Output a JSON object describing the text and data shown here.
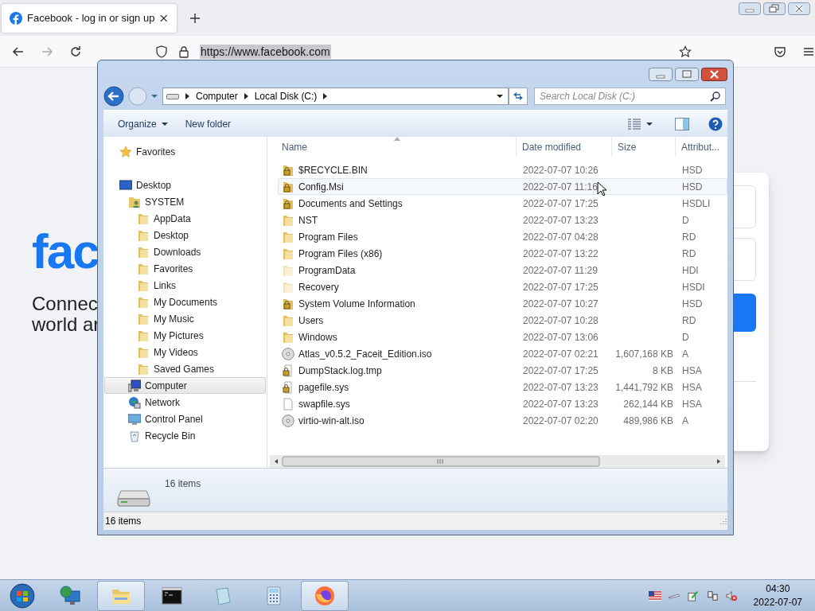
{
  "browser": {
    "tab": {
      "title": "Facebook - log in or sign up"
    },
    "url": "https://www.facebook.com",
    "page": {
      "logo": "fac",
      "tagline": [
        "Connec",
        "world ar"
      ]
    }
  },
  "dialog": {
    "breadcrumb": [
      "Computer",
      "Local Disk (C:)"
    ],
    "search": {
      "placeholder": "Search Local Disk (C:)"
    },
    "organize": "Organize",
    "new_folder": "New folder",
    "sidebar": [
      {
        "label": "Favorites",
        "kind": "favorites",
        "selected": false
      },
      {
        "label": "Desktop",
        "kind": "desktop",
        "selected": false,
        "children": [
          {
            "label": "SYSTEM",
            "kind": "user",
            "selected": false,
            "children": [
              {
                "label": "AppData",
                "kind": "folder",
                "selected": false
              },
              {
                "label": "Desktop",
                "kind": "folder",
                "selected": false
              },
              {
                "label": "Downloads",
                "kind": "folder",
                "selected": false
              },
              {
                "label": "Favorites",
                "kind": "folder",
                "selected": false
              },
              {
                "label": "Links",
                "kind": "folder",
                "selected": false
              },
              {
                "label": "My Documents",
                "kind": "folder",
                "selected": false
              },
              {
                "label": "My Music",
                "kind": "folder",
                "selected": false
              },
              {
                "label": "My Pictures",
                "kind": "folder",
                "selected": false
              },
              {
                "label": "My Videos",
                "kind": "folder",
                "selected": false
              },
              {
                "label": "Saved Games",
                "kind": "folder",
                "selected": false
              }
            ]
          },
          {
            "label": "Computer",
            "kind": "computer",
            "selected": true
          },
          {
            "label": "Network",
            "kind": "network",
            "selected": false
          },
          {
            "label": "Control Panel",
            "kind": "control-panel",
            "selected": false
          },
          {
            "label": "Recycle Bin",
            "kind": "recycle-bin",
            "selected": false
          }
        ]
      }
    ],
    "columns": [
      "Name",
      "Date modified",
      "Size",
      "Attribut..."
    ],
    "files": [
      {
        "name": "$RECYCLE.BIN",
        "date": "2022-07-07 10:26",
        "attributes": "HSD",
        "kind": "locked-folder",
        "highlighted": false
      },
      {
        "name": "Config.Msi",
        "date": "2022-07-07 11:16",
        "attributes": "HSD",
        "kind": "locked-folder",
        "highlighted": true
      },
      {
        "name": "Documents and Settings",
        "date": "2022-07-07 17:25",
        "attributes": "HSDLI",
        "kind": "locked-folder",
        "highlighted": false
      },
      {
        "name": "NST",
        "date": "2022-07-07 13:23",
        "attributes": "D",
        "kind": "folder",
        "highlighted": false
      },
      {
        "name": "Program Files",
        "date": "2022-07-07 04:28",
        "attributes": "RD",
        "kind": "folder",
        "highlighted": false
      },
      {
        "name": "Program Files (x86)",
        "date": "2022-07-07 13:22",
        "attributes": "RD",
        "kind": "folder",
        "highlighted": false
      },
      {
        "name": "ProgramData",
        "date": "2022-07-07 11:29",
        "attributes": "HDI",
        "kind": "faded-folder",
        "highlighted": false
      },
      {
        "name": "Recovery",
        "date": "2022-07-07 17:25",
        "attributes": "HSDI",
        "kind": "faded-folder",
        "highlighted": false
      },
      {
        "name": "System Volume Information",
        "date": "2022-07-07 10:27",
        "attributes": "HSD",
        "kind": "locked-folder",
        "highlighted": false
      },
      {
        "name": "Users",
        "date": "2022-07-07 10:28",
        "attributes": "RD",
        "kind": "folder",
        "highlighted": false
      },
      {
        "name": "Windows",
        "date": "2022-07-07 13:06",
        "attributes": "D",
        "kind": "folder",
        "highlighted": false
      },
      {
        "name": "Atlas_v0.5.2_Faceit_Edition.iso",
        "date": "2022-07-07 02:21",
        "size": "1,607,168 KB",
        "attributes": "A",
        "kind": "disc",
        "highlighted": false
      },
      {
        "name": "DumpStack.log.tmp",
        "date": "2022-07-07 17:25",
        "size": "8 KB",
        "attributes": "HSA",
        "kind": "locked-file",
        "highlighted": false
      },
      {
        "name": "pagefile.sys",
        "date": "2022-07-07 13:23",
        "size": "1,441,792 KB",
        "attributes": "HSA",
        "kind": "locked-file",
        "highlighted": false
      },
      {
        "name": "swapfile.sys",
        "date": "2022-07-07 13:23",
        "size": "262,144 KB",
        "attributes": "HSA",
        "kind": "file",
        "highlighted": false
      },
      {
        "name": "virtio-win-alt.iso",
        "date": "2022-07-07 02:20",
        "size": "489,986 KB",
        "attributes": "A",
        "kind": "disc",
        "highlighted": false
      }
    ],
    "details": {
      "count": "16 items"
    },
    "status": "16 items"
  },
  "taskbar": {
    "apps": [
      {
        "kind": "network",
        "active": false
      },
      {
        "kind": "explorer",
        "active": true
      },
      {
        "kind": "terminal",
        "active": false
      },
      {
        "kind": "notepad",
        "active": false
      },
      {
        "kind": "calculator",
        "active": false
      },
      {
        "kind": "firefox",
        "active": true
      }
    ],
    "clock": {
      "time": "04:30",
      "date": "2022-07-07"
    }
  }
}
